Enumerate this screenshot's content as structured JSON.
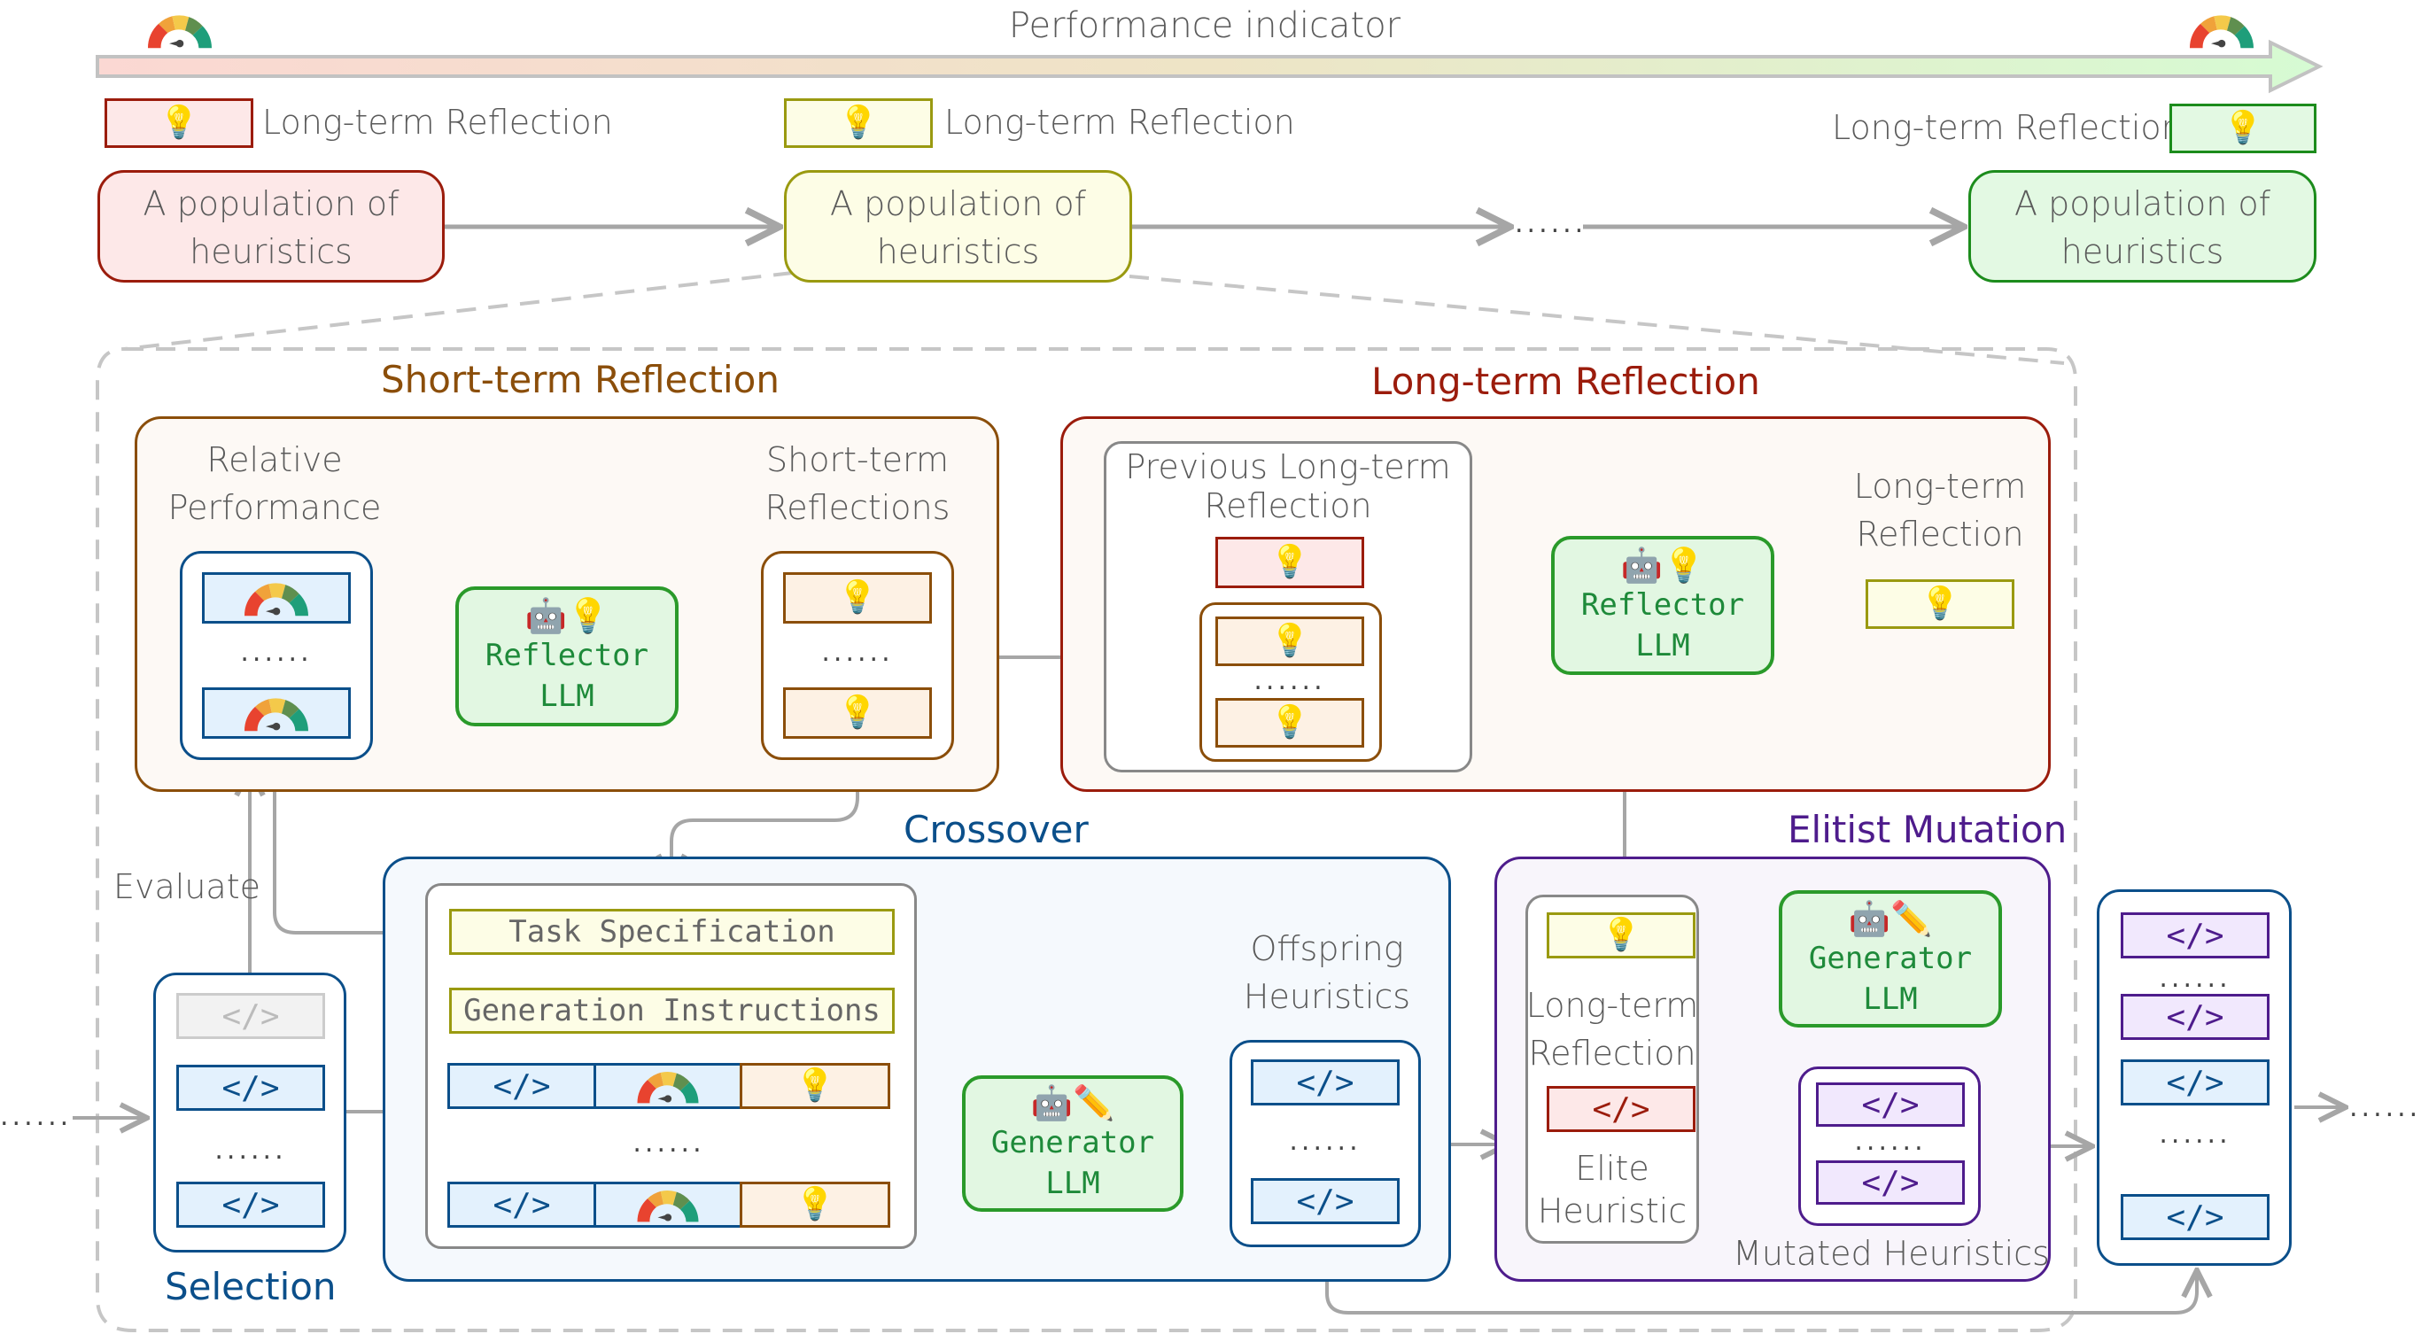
{
  "header": {
    "performance_indicator": "Performance indicator",
    "gauge_icon": "gauge-icon",
    "gradient_from": "#fbd8d3",
    "gradient_to": "#d6fbd3"
  },
  "legend": [
    {
      "label": "Long-term Reflection",
      "icon": "lightbulb-icon",
      "fill": "#fde8e8",
      "border": "#9b1c0c"
    },
    {
      "label": "Long-term Reflection",
      "icon": "lightbulb-icon",
      "fill": "#fdfde6",
      "border": "#9a9a10"
    },
    {
      "label": "Long-term Reflection",
      "icon": "lightbulb-icon",
      "fill": "#e3f9e3",
      "border": "#1c8c1c"
    }
  ],
  "populations": [
    {
      "line1": "A population of",
      "line2": "heuristics"
    },
    {
      "line1": "A population of",
      "line2": "heuristics"
    },
    {
      "line1": "A population of",
      "line2": "heuristics"
    }
  ],
  "ellipsis": "......",
  "icons": {
    "code": "</>",
    "bulb": "💡",
    "robot": "🤖",
    "pencil": "✏️",
    "gauge": "gauge-icon"
  },
  "short_term": {
    "title": "Short-term Reflection",
    "relative_performance": [
      "Relative",
      "Performance"
    ],
    "short_term_reflections": [
      "Short-term",
      "Reflections"
    ],
    "reflector": {
      "name": "Reflector",
      "sub": "LLM"
    }
  },
  "long_term": {
    "title": "Long-term Reflection",
    "previous": [
      "Previous Long-term",
      "Reflection"
    ],
    "output": [
      "Long-term",
      "Reflection"
    ],
    "reflector": {
      "name": "Reflector",
      "sub": "LLM"
    }
  },
  "crossover": {
    "title": "Crossover",
    "task_spec": "Task Specification",
    "gen_instr": "Generation Instructions",
    "generator": {
      "name": "Generator",
      "sub": "LLM"
    },
    "offspring": [
      "Offspring",
      "Heuristics"
    ]
  },
  "mutation": {
    "title": "Elitist Mutation",
    "ltr": [
      "Long-term",
      "Reflection"
    ],
    "elite": [
      "Elite",
      "Heuristic"
    ],
    "generator": {
      "name": "Generator",
      "sub": "LLM"
    },
    "mutated": "Mutated Heuristics"
  },
  "selection": {
    "title": "Selection",
    "evaluate": "Evaluate"
  },
  "colors": {
    "blue": "#0b4f8a",
    "blue_fill": "#e3f1fd",
    "brown": "#8b4e0a",
    "brown_fill": "#fdf1e4",
    "red": "#9b1c0c",
    "red_fill": "#fde8e8",
    "olive": "#9a9a10",
    "olive_fill": "#fdfde6",
    "green": "#1c8c1c",
    "green_fill": "#e3f9e3",
    "purple": "#4e1c8c",
    "purple_fill": "#f1e8fd",
    "gray": "#888888"
  }
}
